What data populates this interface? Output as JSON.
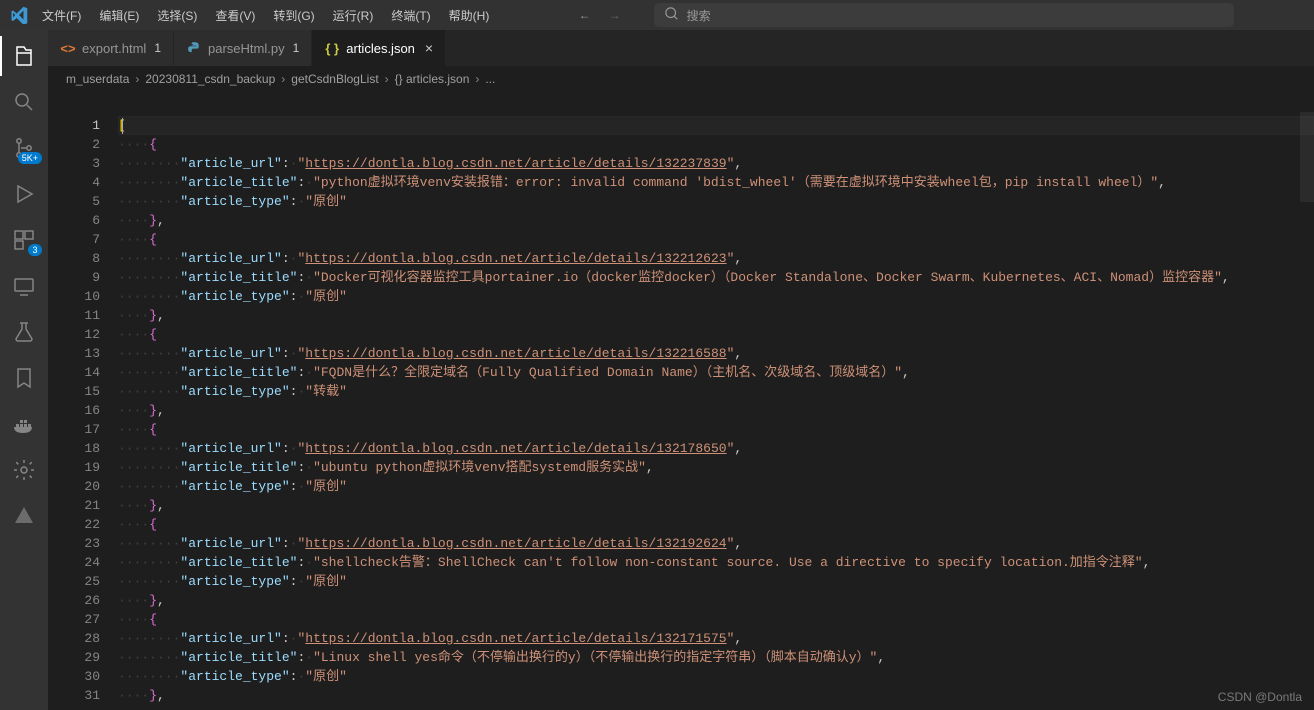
{
  "menubar": [
    "文件(F)",
    "编辑(E)",
    "选择(S)",
    "查看(V)",
    "转到(G)",
    "运行(R)",
    "终端(T)",
    "帮助(H)"
  ],
  "search": {
    "placeholder": "搜索"
  },
  "activity_badges": {
    "scm": "5K+",
    "ext": "3"
  },
  "tabs": [
    {
      "icon": "html",
      "icon_color": "#e37933",
      "label": "export.html",
      "dirty": "1",
      "active": false
    },
    {
      "icon": "python",
      "icon_color": "#519aba",
      "label": "parseHtml.py",
      "dirty": "1",
      "active": false
    },
    {
      "icon": "json",
      "icon_color": "#cbcb41",
      "label": "articles.json",
      "dirty": "",
      "active": true,
      "close": true
    }
  ],
  "breadcrumbs": [
    "m_userdata",
    "20230811_csdn_backup",
    "getCsdnBlogList",
    "{} articles.json",
    "..."
  ],
  "lines_count": 31,
  "current_line": 1,
  "code": [
    {
      "n": 1,
      "t": "cur",
      "tokens": [
        [
          "br",
          "["
        ],
        [
          "cursor",
          ""
        ]
      ]
    },
    {
      "n": 2,
      "tokens": [
        [
          "ws",
          "····"
        ],
        [
          "br2",
          "{"
        ]
      ]
    },
    {
      "n": 3,
      "tokens": [
        [
          "ws",
          "········"
        ],
        [
          "key",
          "\"article_url\""
        ],
        [
          "pun",
          ":"
        ],
        [
          "ws",
          "·"
        ],
        [
          "str",
          "\""
        ],
        [
          "lnk",
          "https://dontla.blog.csdn.net/article/details/132237839"
        ],
        [
          "str",
          "\""
        ],
        [
          "pun",
          ","
        ]
      ]
    },
    {
      "n": 4,
      "tokens": [
        [
          "ws",
          "········"
        ],
        [
          "key",
          "\"article_title\""
        ],
        [
          "pun",
          ":"
        ],
        [
          "ws",
          "·"
        ],
        [
          "str",
          "\"python虚拟环境venv安装报错：error: invalid command 'bdist_wheel'（需要在虚拟环境中安装wheel包，pip install wheel）\""
        ],
        [
          "pun",
          ","
        ]
      ]
    },
    {
      "n": 5,
      "tokens": [
        [
          "ws",
          "········"
        ],
        [
          "key",
          "\"article_type\""
        ],
        [
          "pun",
          ":"
        ],
        [
          "ws",
          "·"
        ],
        [
          "str",
          "\"原创\""
        ]
      ]
    },
    {
      "n": 6,
      "tokens": [
        [
          "ws",
          "····"
        ],
        [
          "br2",
          "}"
        ],
        [
          "pun",
          ","
        ]
      ]
    },
    {
      "n": 7,
      "tokens": [
        [
          "ws",
          "····"
        ],
        [
          "br2",
          "{"
        ]
      ]
    },
    {
      "n": 8,
      "tokens": [
        [
          "ws",
          "········"
        ],
        [
          "key",
          "\"article_url\""
        ],
        [
          "pun",
          ":"
        ],
        [
          "ws",
          "·"
        ],
        [
          "str",
          "\""
        ],
        [
          "lnk",
          "https://dontla.blog.csdn.net/article/details/132212623"
        ],
        [
          "str",
          "\""
        ],
        [
          "pun",
          ","
        ]
      ]
    },
    {
      "n": 9,
      "tokens": [
        [
          "ws",
          "········"
        ],
        [
          "key",
          "\"article_title\""
        ],
        [
          "pun",
          ":"
        ],
        [
          "ws",
          "·"
        ],
        [
          "str",
          "\"Docker可视化容器监控工具portainer.io（docker监控docker）（Docker Standalone、Docker Swarm、Kubernetes、ACI、Nomad）监控容器\""
        ],
        [
          "pun",
          ","
        ]
      ]
    },
    {
      "n": 10,
      "tokens": [
        [
          "ws",
          "········"
        ],
        [
          "key",
          "\"article_type\""
        ],
        [
          "pun",
          ":"
        ],
        [
          "ws",
          "·"
        ],
        [
          "str",
          "\"原创\""
        ]
      ]
    },
    {
      "n": 11,
      "tokens": [
        [
          "ws",
          "····"
        ],
        [
          "br2",
          "}"
        ],
        [
          "pun",
          ","
        ]
      ]
    },
    {
      "n": 12,
      "tokens": [
        [
          "ws",
          "····"
        ],
        [
          "br2",
          "{"
        ]
      ]
    },
    {
      "n": 13,
      "tokens": [
        [
          "ws",
          "········"
        ],
        [
          "key",
          "\"article_url\""
        ],
        [
          "pun",
          ":"
        ],
        [
          "ws",
          "·"
        ],
        [
          "str",
          "\""
        ],
        [
          "lnk",
          "https://dontla.blog.csdn.net/article/details/132216588"
        ],
        [
          "str",
          "\""
        ],
        [
          "pun",
          ","
        ]
      ]
    },
    {
      "n": 14,
      "tokens": [
        [
          "ws",
          "········"
        ],
        [
          "key",
          "\"article_title\""
        ],
        [
          "pun",
          ":"
        ],
        [
          "ws",
          "·"
        ],
        [
          "str",
          "\"FQDN是什么？全限定域名（Fully Qualified Domain Name）（主机名、次级域名、顶级域名）\""
        ],
        [
          "pun",
          ","
        ]
      ]
    },
    {
      "n": 15,
      "tokens": [
        [
          "ws",
          "········"
        ],
        [
          "key",
          "\"article_type\""
        ],
        [
          "pun",
          ":"
        ],
        [
          "ws",
          "·"
        ],
        [
          "str",
          "\"转载\""
        ]
      ]
    },
    {
      "n": 16,
      "tokens": [
        [
          "ws",
          "····"
        ],
        [
          "br2",
          "}"
        ],
        [
          "pun",
          ","
        ]
      ]
    },
    {
      "n": 17,
      "tokens": [
        [
          "ws",
          "····"
        ],
        [
          "br2",
          "{"
        ]
      ]
    },
    {
      "n": 18,
      "tokens": [
        [
          "ws",
          "········"
        ],
        [
          "key",
          "\"article_url\""
        ],
        [
          "pun",
          ":"
        ],
        [
          "ws",
          "·"
        ],
        [
          "str",
          "\""
        ],
        [
          "lnk",
          "https://dontla.blog.csdn.net/article/details/132178650"
        ],
        [
          "str",
          "\""
        ],
        [
          "pun",
          ","
        ]
      ]
    },
    {
      "n": 19,
      "tokens": [
        [
          "ws",
          "········"
        ],
        [
          "key",
          "\"article_title\""
        ],
        [
          "pun",
          ":"
        ],
        [
          "ws",
          "·"
        ],
        [
          "str",
          "\"ubuntu python虚拟环境venv搭配systemd服务实战\""
        ],
        [
          "pun",
          ","
        ]
      ]
    },
    {
      "n": 20,
      "tokens": [
        [
          "ws",
          "········"
        ],
        [
          "key",
          "\"article_type\""
        ],
        [
          "pun",
          ":"
        ],
        [
          "ws",
          "·"
        ],
        [
          "str",
          "\"原创\""
        ]
      ]
    },
    {
      "n": 21,
      "tokens": [
        [
          "ws",
          "····"
        ],
        [
          "br2",
          "}"
        ],
        [
          "pun",
          ","
        ]
      ]
    },
    {
      "n": 22,
      "tokens": [
        [
          "ws",
          "····"
        ],
        [
          "br2",
          "{"
        ]
      ]
    },
    {
      "n": 23,
      "tokens": [
        [
          "ws",
          "········"
        ],
        [
          "key",
          "\"article_url\""
        ],
        [
          "pun",
          ":"
        ],
        [
          "ws",
          "·"
        ],
        [
          "str",
          "\""
        ],
        [
          "lnk",
          "https://dontla.blog.csdn.net/article/details/132192624"
        ],
        [
          "str",
          "\""
        ],
        [
          "pun",
          ","
        ]
      ]
    },
    {
      "n": 24,
      "tokens": [
        [
          "ws",
          "········"
        ],
        [
          "key",
          "\"article_title\""
        ],
        [
          "pun",
          ":"
        ],
        [
          "ws",
          "·"
        ],
        [
          "str",
          "\"shellcheck告警：ShellCheck can't follow non-constant source. Use a directive to specify location.加指令注释\""
        ],
        [
          "pun",
          ","
        ]
      ]
    },
    {
      "n": 25,
      "tokens": [
        [
          "ws",
          "········"
        ],
        [
          "key",
          "\"article_type\""
        ],
        [
          "pun",
          ":"
        ],
        [
          "ws",
          "·"
        ],
        [
          "str",
          "\"原创\""
        ]
      ]
    },
    {
      "n": 26,
      "tokens": [
        [
          "ws",
          "····"
        ],
        [
          "br2",
          "}"
        ],
        [
          "pun",
          ","
        ]
      ]
    },
    {
      "n": 27,
      "tokens": [
        [
          "ws",
          "····"
        ],
        [
          "br2",
          "{"
        ]
      ]
    },
    {
      "n": 28,
      "tokens": [
        [
          "ws",
          "········"
        ],
        [
          "key",
          "\"article_url\""
        ],
        [
          "pun",
          ":"
        ],
        [
          "ws",
          "·"
        ],
        [
          "str",
          "\""
        ],
        [
          "lnk",
          "https://dontla.blog.csdn.net/article/details/132171575"
        ],
        [
          "str",
          "\""
        ],
        [
          "pun",
          ","
        ]
      ]
    },
    {
      "n": 29,
      "tokens": [
        [
          "ws",
          "········"
        ],
        [
          "key",
          "\"article_title\""
        ],
        [
          "pun",
          ":"
        ],
        [
          "ws",
          "·"
        ],
        [
          "str",
          "\"Linux shell yes命令（不停输出换行的y）（不停输出换行的指定字符串）（脚本自动确认y）\""
        ],
        [
          "pun",
          ","
        ]
      ]
    },
    {
      "n": 30,
      "tokens": [
        [
          "ws",
          "········"
        ],
        [
          "key",
          "\"article_type\""
        ],
        [
          "pun",
          ":"
        ],
        [
          "ws",
          "·"
        ],
        [
          "str",
          "\"原创\""
        ]
      ]
    },
    {
      "n": 31,
      "tokens": [
        [
          "ws",
          "····"
        ],
        [
          "br2",
          "}"
        ],
        [
          "pun",
          ","
        ]
      ]
    }
  ],
  "watermark": "CSDN @Dontla"
}
